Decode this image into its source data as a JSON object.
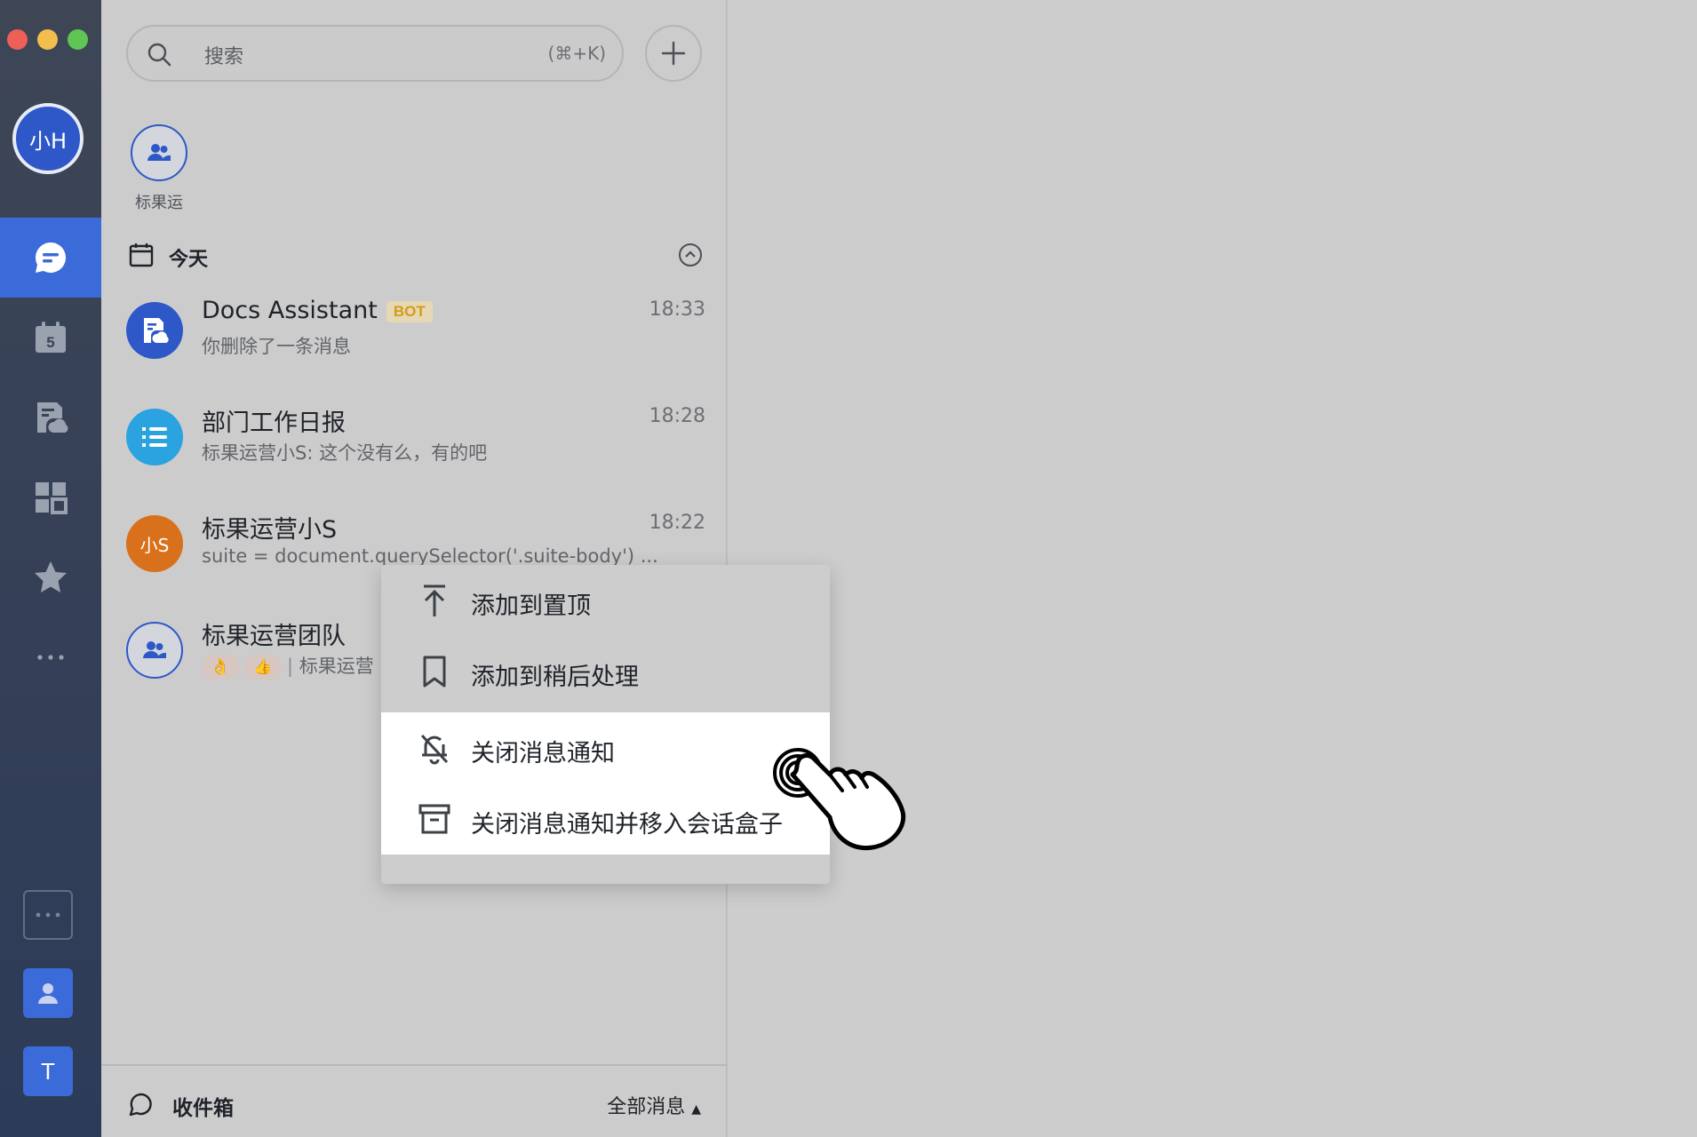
{
  "rail": {
    "user_avatar": "小H",
    "calendar_day": "5",
    "team_avatar": "T",
    "nav": [
      "chat-icon",
      "calendar-icon",
      "docs-icon",
      "workplace-icon",
      "favorites-icon",
      "more-icon"
    ]
  },
  "search": {
    "placeholder": "搜索",
    "shortcut": "(⌘+K)"
  },
  "pinned": {
    "label": "标果运"
  },
  "section": {
    "title": "今天"
  },
  "chats": [
    {
      "name": "Docs Assistant",
      "badge": "BOT",
      "time": "18:33",
      "preview": "你删除了一条消息",
      "avatar_color": "#2e58c8"
    },
    {
      "name": "部门工作日报",
      "time": "18:28",
      "preview": "标果运营小S: 这个没有么，有的吧",
      "avatar_color": "#2aa3e0"
    },
    {
      "name": "标果运营小S",
      "avatar_text": "小S",
      "time": "18:22",
      "preview": "suite = document.querySelector('.suite-body') ...",
      "avatar_color": "#d9711c"
    },
    {
      "name": "标果运营团队",
      "preview": "标果运营",
      "avatar_color": "#2e58c8"
    }
  ],
  "menu": {
    "items": [
      {
        "label": "添加到置顶",
        "icon": "pin-top-icon"
      },
      {
        "label": "添加到稍后处理",
        "icon": "bookmark-icon"
      },
      {
        "label": "关闭消息通知",
        "icon": "bell-off-icon",
        "highlighted": true
      },
      {
        "label": "关闭消息通知并移入会话盒子",
        "icon": "archive-box-icon",
        "highlighted": true
      }
    ]
  },
  "footer": {
    "inbox_label": "收件箱",
    "filter_label": "全部消息"
  }
}
